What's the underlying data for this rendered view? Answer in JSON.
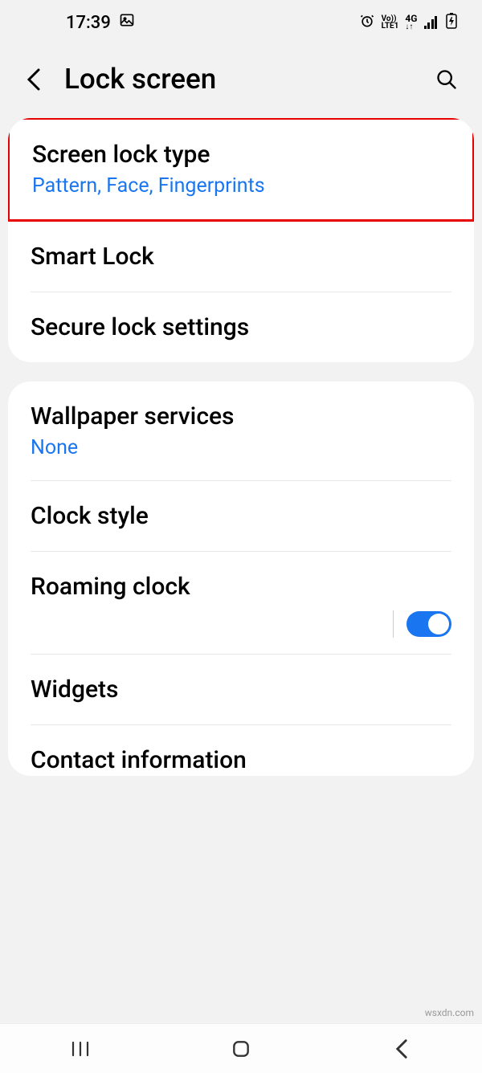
{
  "status": {
    "time": "17:39",
    "volte_top": "Vo))",
    "volte_bottom": "LTE1",
    "network": "4G"
  },
  "header": {
    "title": "Lock screen"
  },
  "section1": {
    "screen_lock_type": {
      "title": "Screen lock type",
      "subtitle": "Pattern, Face, Fingerprints"
    },
    "smart_lock": {
      "title": "Smart Lock"
    },
    "secure_lock": {
      "title": "Secure lock settings"
    }
  },
  "section2": {
    "wallpaper": {
      "title": "Wallpaper services",
      "subtitle": "None"
    },
    "clock_style": {
      "title": "Clock style"
    },
    "roaming_clock": {
      "title": "Roaming clock",
      "toggle": true
    },
    "widgets": {
      "title": "Widgets"
    },
    "contact_info": {
      "title": "Contact information"
    }
  },
  "watermark": "wsxdn.com"
}
